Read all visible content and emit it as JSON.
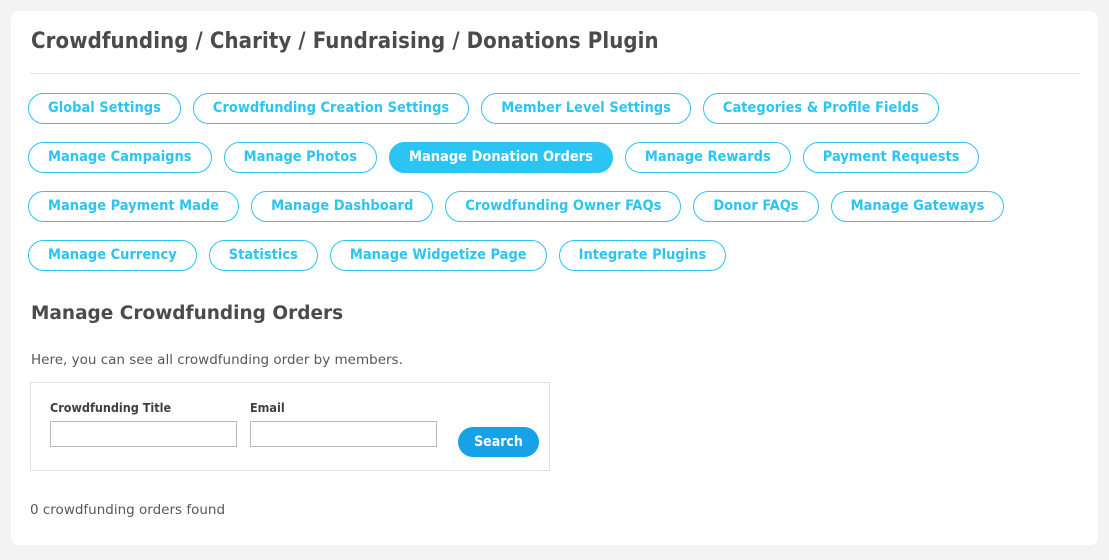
{
  "page": {
    "title": "Crowdfunding / Charity / Fundraising / Donations Plugin",
    "background_color": "#f3f3f4",
    "card_color": "#ffffff"
  },
  "theme": {
    "accent_cyan": "#2bc4f3",
    "button_blue": "#17a2e8",
    "text_dark": "#4b4b4b",
    "text_body": "#585858",
    "border_gray": "#e0e0e0"
  },
  "tabs": [
    {
      "label": "Global Settings",
      "active": false
    },
    {
      "label": "Crowdfunding Creation Settings",
      "active": false
    },
    {
      "label": "Member Level Settings",
      "active": false
    },
    {
      "label": "Categories & Profile Fields",
      "active": false,
      "break_after": true
    },
    {
      "label": "Manage Campaigns",
      "active": false
    },
    {
      "label": "Manage Photos",
      "active": false
    },
    {
      "label": "Manage Donation Orders",
      "active": true
    },
    {
      "label": "Manage Rewards",
      "active": false
    },
    {
      "label": "Payment Requests",
      "active": false,
      "break_after": true
    },
    {
      "label": "Manage Payment Made",
      "active": false
    },
    {
      "label": "Manage Dashboard",
      "active": false
    },
    {
      "label": "Crowdfunding Owner FAQs",
      "active": false
    },
    {
      "label": "Donor FAQs",
      "active": false
    },
    {
      "label": "Manage Gateways",
      "active": false,
      "break_after": true
    },
    {
      "label": "Manage Currency",
      "active": false
    },
    {
      "label": "Statistics",
      "active": false
    },
    {
      "label": "Manage Widgetize Page",
      "active": false
    },
    {
      "label": "Integrate Plugins",
      "active": false
    }
  ],
  "section": {
    "heading": "Manage Crowdfunding Orders",
    "description": "Here, you can see all crowdfunding order by members."
  },
  "search_form": {
    "title_field": {
      "label": "Crowdfunding Title",
      "value": "",
      "placeholder": ""
    },
    "email_field": {
      "label": "Email",
      "value": "",
      "placeholder": ""
    },
    "search_button_label": "Search"
  },
  "results": {
    "count_text": "0 crowdfunding orders found"
  }
}
